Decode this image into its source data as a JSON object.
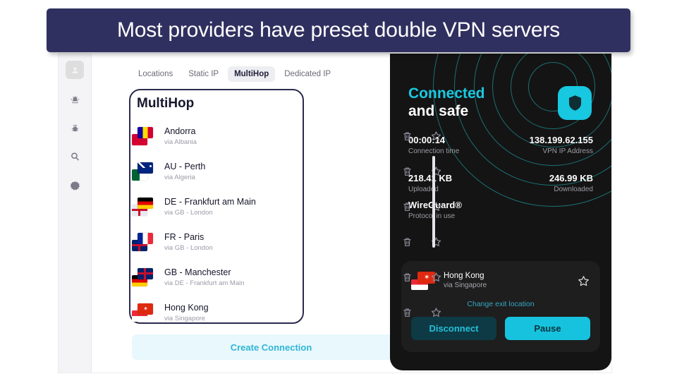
{
  "banner": {
    "text": "Most providers have preset double VPN servers"
  },
  "sidebar": {
    "items": [
      {
        "name": "account-icon",
        "label": "Account"
      },
      {
        "name": "alert-icon",
        "label": "Alerts"
      },
      {
        "name": "threat-protection-icon",
        "label": "Threat Protection"
      },
      {
        "name": "search-icon",
        "label": "Search"
      },
      {
        "name": "settings-icon",
        "label": "Settings"
      }
    ]
  },
  "tabs": [
    {
      "label": "Locations",
      "active": false
    },
    {
      "label": "Static IP",
      "active": false
    },
    {
      "label": "MultiHop",
      "active": true
    },
    {
      "label": "Dedicated IP",
      "active": false
    }
  ],
  "panel": {
    "title": "MultiHop",
    "create_button": "Create Connection",
    "row_actions": {
      "delete": "delete-icon",
      "favorite": "star-icon"
    }
  },
  "connections": [
    {
      "name": "Andorra",
      "via": "via Albania",
      "front_flag": [
        "#10069f",
        "#fedd00",
        "#d50032"
      ],
      "back_flag": [
        "#d50032",
        "#d50032",
        "#d50032"
      ]
    },
    {
      "name": "AU - Perth",
      "via": "via Algeria",
      "front_flag": [
        "#00247d",
        "#00247d",
        "#00247d"
      ],
      "back_flag": [
        "#006233",
        "#ffffff",
        "#006233"
      ]
    },
    {
      "name": "DE - Frankfurt am Main",
      "via": "via GB - London",
      "front_flag": [
        "#000000",
        "#dd0000",
        "#ffce00"
      ],
      "back_flag": [
        "#e3e6f0",
        "#c8102e",
        "#e3e6f0"
      ]
    },
    {
      "name": "FR - Paris",
      "via": "via GB - London",
      "front_flag": [
        "#002395",
        "#ffffff",
        "#ed2939"
      ],
      "back_flag": [
        "#012169",
        "#c8102e",
        "#012169"
      ]
    },
    {
      "name": "GB - Manchester",
      "via": "via DE - Frankfurt am Main",
      "front_flag": [
        "#012169",
        "#c8102e",
        "#012169"
      ],
      "back_flag": [
        "#000000",
        "#dd0000",
        "#ffce00"
      ]
    },
    {
      "name": "Hong Kong",
      "via": "via Singapore",
      "front_flag": [
        "#de2910",
        "#de2910",
        "#de2910"
      ],
      "back_flag": [
        "#ed2939",
        "#ffffff",
        "#ffffff"
      ]
    }
  ],
  "status": {
    "line1": "Connected",
    "line2": "and safe",
    "shield_icon": "shield-icon"
  },
  "stats": [
    {
      "value": "00:00:14",
      "label": "Connection time",
      "align": "left"
    },
    {
      "value": "138.199.62.155",
      "label": "VPN IP Address",
      "align": "right"
    },
    {
      "value": "218.41 KB",
      "label": "Uploaded",
      "align": "left"
    },
    {
      "value": "246.99 KB",
      "label": "Downloaded",
      "align": "right"
    }
  ],
  "protocol": {
    "value": "WireGuard®",
    "label": "Protocol in use"
  },
  "active_connection": {
    "name": "Hong Kong",
    "via": "via Singapore",
    "change_link": "Change exit location",
    "disconnect_label": "Disconnect",
    "pause_label": "Pause",
    "favorite_icon": "star-icon"
  },
  "colors": {
    "banner_bg": "#303060",
    "accent_cyan": "#18c7e0",
    "dark_panel": "#141414",
    "highlight_border": "#2b2b4f"
  }
}
